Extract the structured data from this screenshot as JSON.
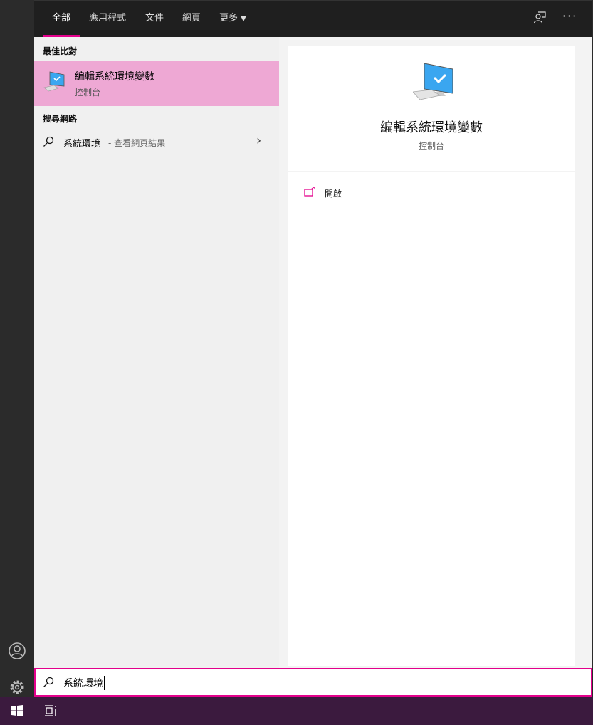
{
  "tabs": [
    {
      "label": "全部",
      "active": true
    },
    {
      "label": "應用程式"
    },
    {
      "label": "文件"
    },
    {
      "label": "網頁"
    },
    {
      "label": "更多"
    }
  ],
  "header_icons": [
    "feedback-icon",
    "more-options-icon"
  ],
  "best_match": {
    "heading": "最佳比對",
    "title": "編輯系統環境變數",
    "subtitle": "控制台"
  },
  "web_search": {
    "heading": "搜尋網路",
    "query": "系統環境",
    "suffix": " - 查看網頁結果"
  },
  "preview": {
    "title": "編輯系統環境變數",
    "subtitle": "控制台",
    "actions": [
      {
        "label": "開啟",
        "icon": "open-icon"
      }
    ]
  },
  "search": {
    "value": "系統環境"
  },
  "colors": {
    "accent": "#e3008c",
    "selected": "#eea8d4",
    "taskbar": "#3b1a3e"
  }
}
